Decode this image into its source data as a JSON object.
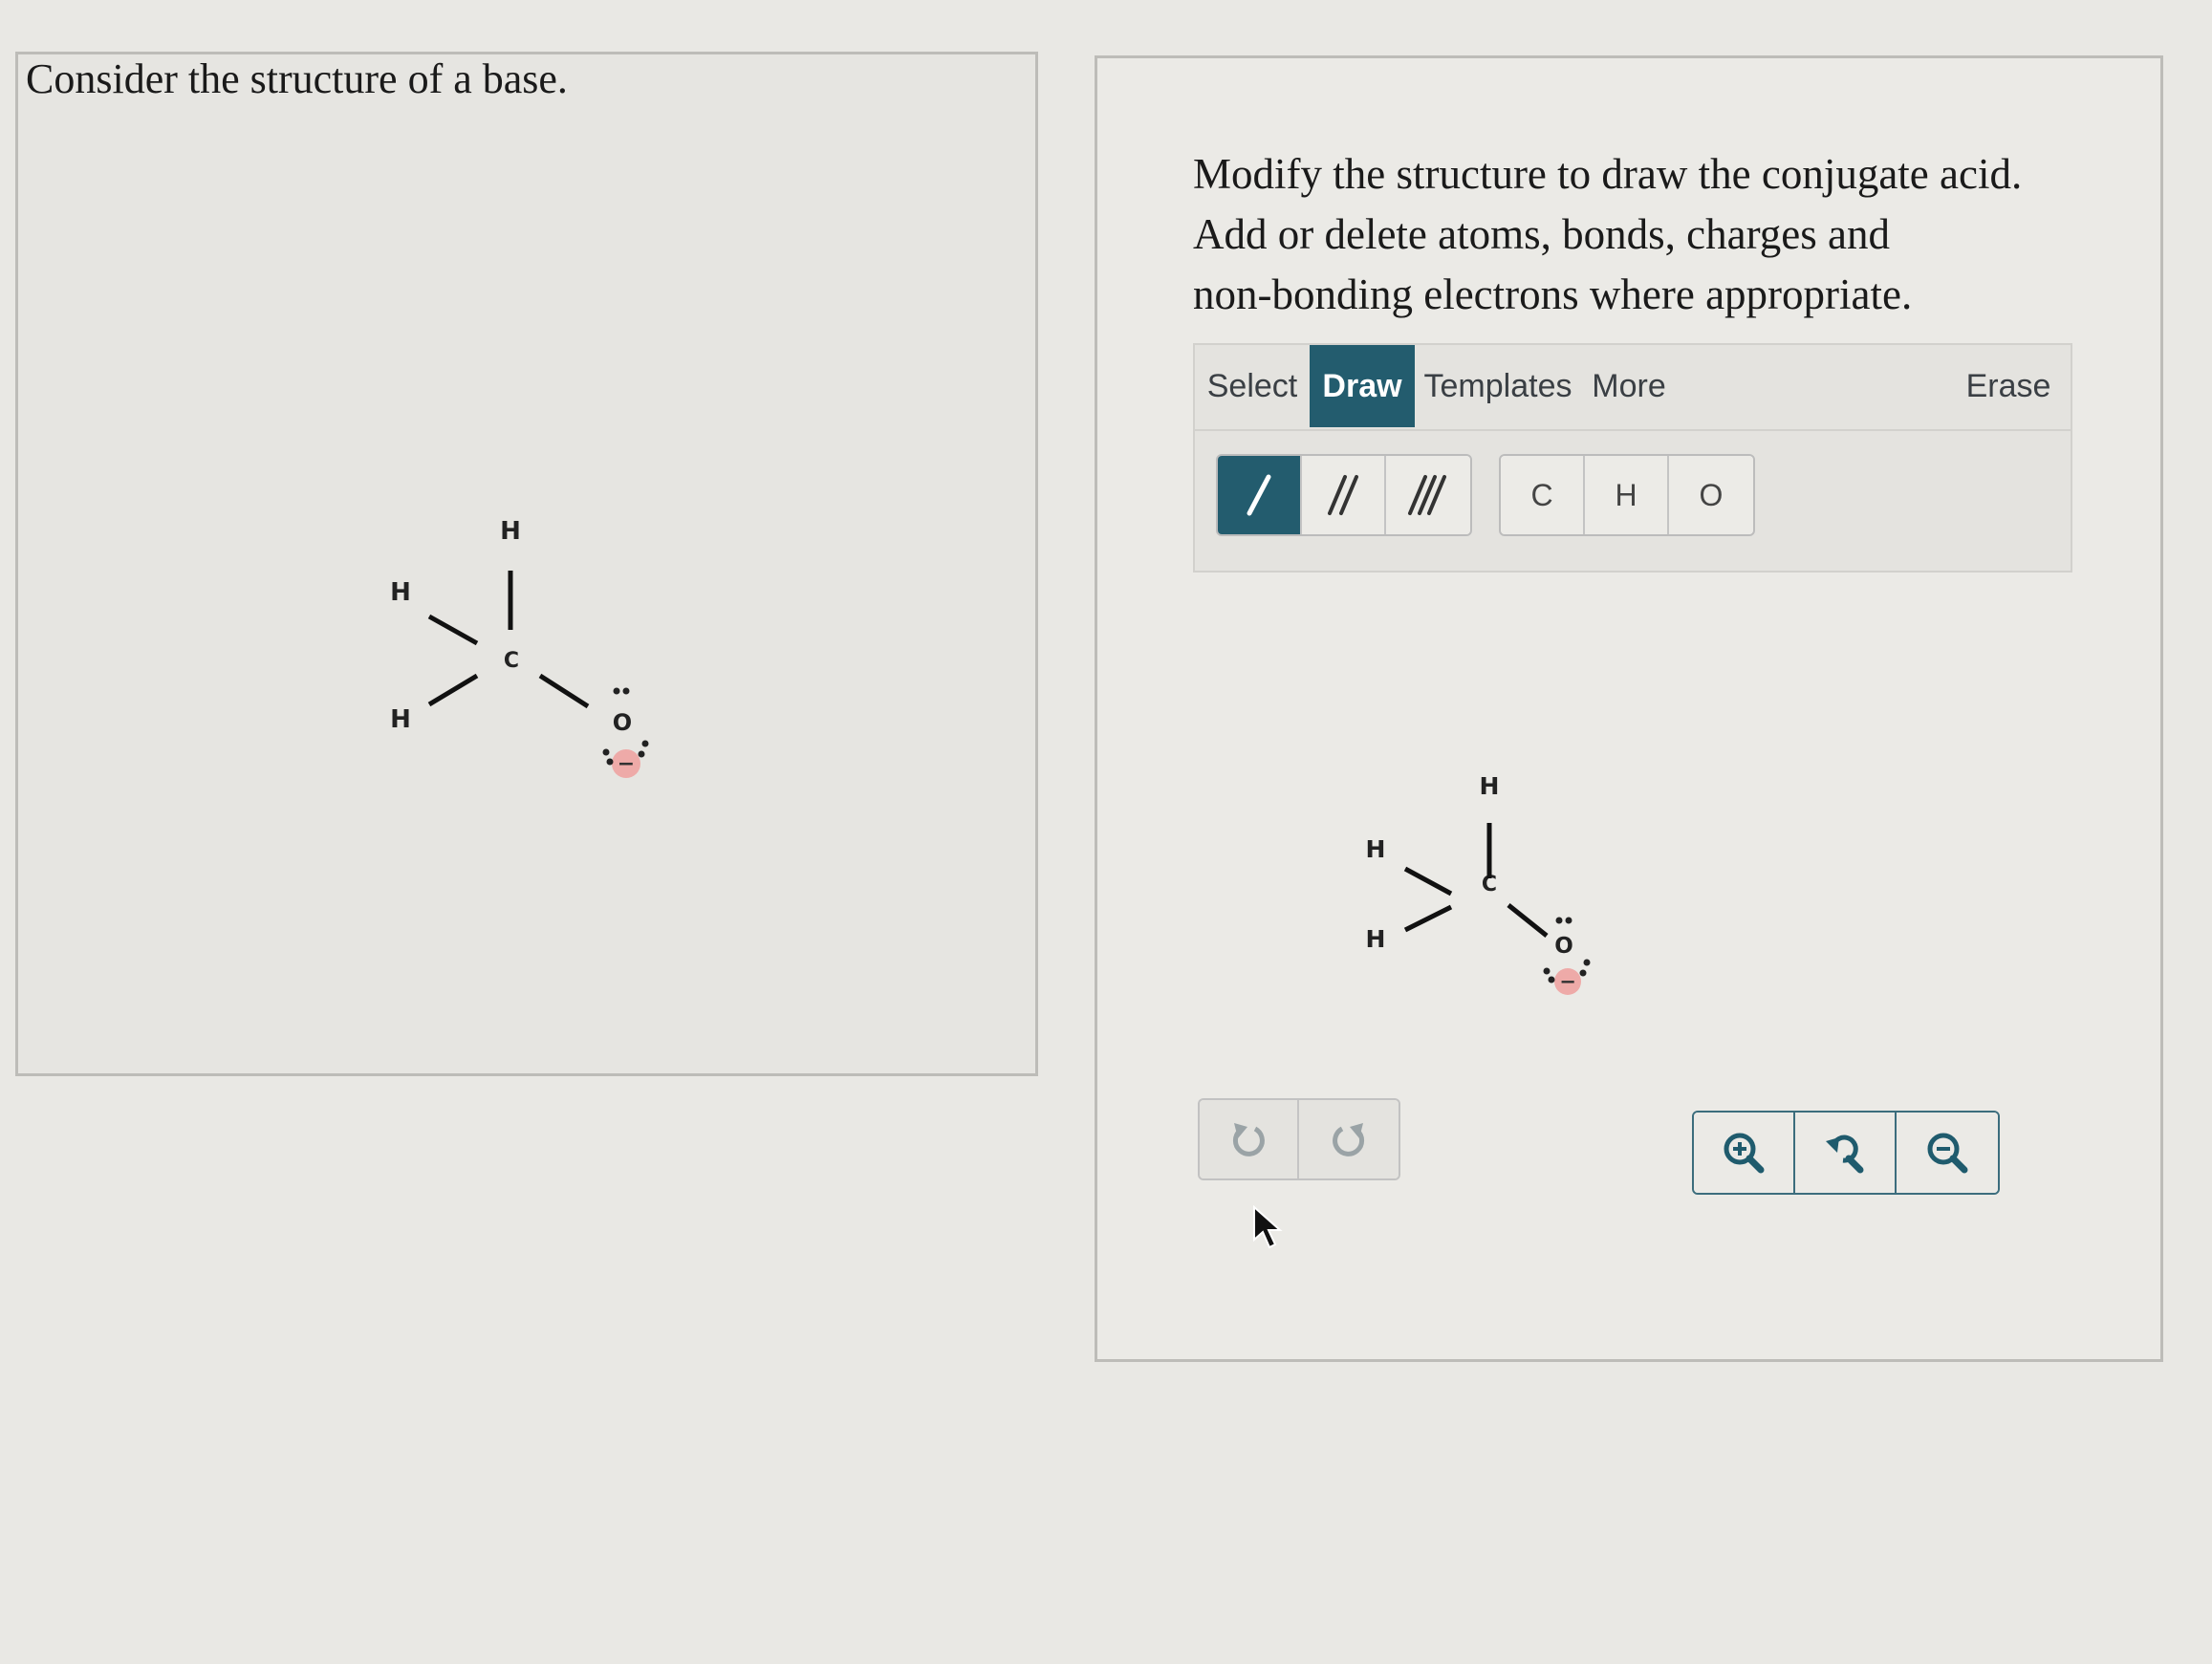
{
  "question": {
    "text": "Consider the structure of a base."
  },
  "instructions": {
    "line1": "Modify the structure to draw the conjugate acid.",
    "line2": "Add or delete atoms, bonds, charges and",
    "line3": "non-bonding electrons where appropriate."
  },
  "toolbar": {
    "tabs": [
      {
        "label": "Select",
        "active": false
      },
      {
        "label": "Draw",
        "active": true
      },
      {
        "label": "Templates",
        "active": false
      },
      {
        "label": "More",
        "active": false
      }
    ],
    "erase_label": "Erase",
    "bond_tools": [
      {
        "name": "single-bond",
        "active": true
      },
      {
        "name": "double-bond",
        "active": false
      },
      {
        "name": "triple-bond",
        "active": false
      }
    ],
    "atom_tools": [
      "C",
      "H",
      "O"
    ]
  },
  "molecule": {
    "atoms": {
      "top_h": "H",
      "upper_left_h": "H",
      "lower_left_h": "H",
      "carbon": "C",
      "oxygen": "O"
    },
    "charge": "−",
    "lone_pairs": 3
  },
  "controls": {
    "undo_icon": "undo-icon",
    "redo_icon": "redo-icon",
    "zoom_in_icon": "zoom-in-icon",
    "zoom_reset_icon": "zoom-reset-icon",
    "zoom_out_icon": "zoom-out-icon"
  },
  "colors": {
    "accent": "#235c6e",
    "charge": "#eeaaa8",
    "background": "#e9e8e4"
  }
}
